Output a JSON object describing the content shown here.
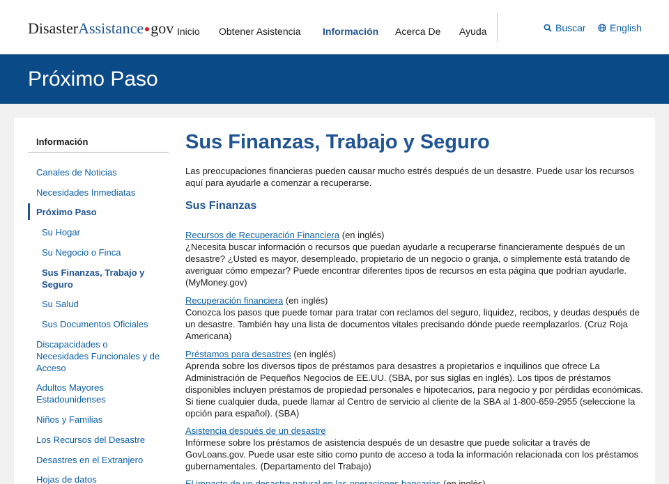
{
  "header": {
    "logo_main": "Disaster",
    "logo_accent": "Assistance",
    "logo_suffix": "gov",
    "nav": [
      "Inicio",
      "Obtener Asistencia",
      "Información",
      "Acerca De",
      "Ayuda"
    ],
    "search_label": "Buscar",
    "language_label": "English"
  },
  "banner": {
    "title": "Próximo Paso"
  },
  "sidebar": {
    "title": "Información",
    "items": [
      "Canales de Noticias",
      "Necesidades Inmediatas",
      "Próximo Paso",
      "Su Hogar",
      "Su Negocio o Finca",
      "Sus Finanzas, Trabajo y Seguro",
      "Su Salud",
      "Sus Documentos Oficiales",
      "Discapacidades o Necesidades Funcionales y de Acceso",
      "Adultos Mayores Estadounidenses",
      "Niños y Familias",
      "Los Recursos del Desastre",
      "Desastres en el Extranjero",
      "Hojas de datos"
    ]
  },
  "main": {
    "title": "Sus Finanzas, Trabajo y Seguro",
    "intro": "Las preocupaciones financieras pueden causar mucho estrés después de un desastre. Puede usar los recursos aquí para ayudarle a comenzar a recuperarse.",
    "section_title": "Sus Finanzas",
    "resources": [
      {
        "link": "Recursos de Recuperación Financiera",
        "note": " (en inglés)",
        "body": "¿Necesita buscar información o recursos que puedan ayudarle a recuperarse financieramente después de un desastre? ¿Usted es mayor, desempleado, propietario de un negocio o granja, o simplemente está tratando de averiguar cómo empezar? Puede encontrar diferentes tipos de recursos en esta página que podrían ayudarle. (MyMoney.gov)"
      },
      {
        "link": "Recuperación financiera",
        "note": " (en inglés)",
        "body": "Conozca los pasos que puede tomar para tratar con reclamos del seguro, liquidez, recibos, y deudas después de un desastre. También hay una lista de documentos vitales precisando dónde puede reemplazarlos. (Cruz Roja Americana)"
      },
      {
        "link": "Préstamos para desastres",
        "note": " (en inglés)",
        "body": "Aprenda sobre los diversos tipos de préstamos para desastres a propietarios e inquilinos que ofrece La Administración de Pequeños Negocios de EE.UU. (SBA, por sus siglas en inglés). Los tipos de préstamos disponibles incluyen préstamos de propiedad personales e hipotecarios, para negocio y por pérdidas económicas. Si tiene cualquier duda, puede llamar al Centro de servicio al cliente de la SBA al 1-800-659-2955 (seleccione la opción para español). (SBA)"
      },
      {
        "link": "Asistencia después de un desastre",
        "note": "",
        "body": "Infórmese sobre los préstamos de asistencia después de un desastre que puede solicitar a través de GovLoans.gov. Puede usar este sitio como punto de acceso a toda la información relacionada con los préstamos gubernamentales. (Departamento del Trabajo)"
      },
      {
        "link": "El impacto de un desastre natural en las operaciones bancarias",
        "note": " (en inglés)",
        "body": ""
      }
    ]
  }
}
